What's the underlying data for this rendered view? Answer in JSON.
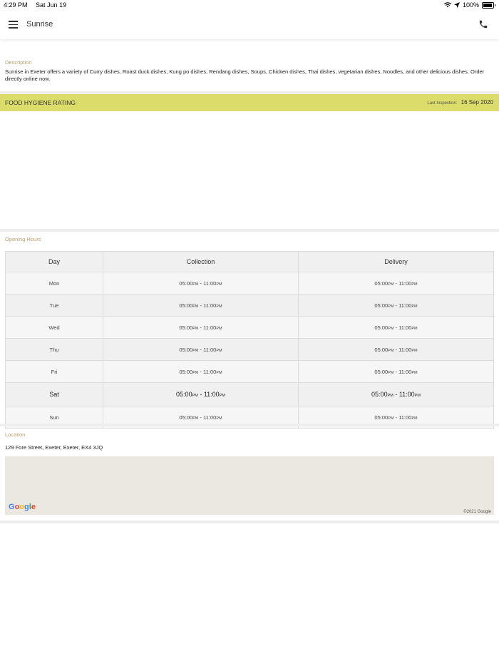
{
  "status_bar": {
    "time": "4:29 PM",
    "date": "Sat Jun 19",
    "battery": "100%"
  },
  "nav": {
    "title": "Sunrise"
  },
  "description": {
    "label": "Description",
    "text": "Sunrise in Exeter offers a variety of Curry dishes, Roast duck dishes, Kung po dishes, Rendang dishes, Soups, Chicken dishes, Thai dishes, vegetarian dishes, Noodles, and other delicious dishes. Order directly online now."
  },
  "hygiene": {
    "title": "FOOD HYGIENE RATING",
    "inspection_label": "Last Inspection:",
    "inspection_date": "16 Sep 2020",
    "bar_color": "#dcdc6a"
  },
  "hours": {
    "label": "Opening Hours",
    "headers": [
      "Day",
      "Collection",
      "Delivery"
    ],
    "rows": [
      {
        "day": "Mon",
        "c_open": "05:00",
        "c_close": "11:00",
        "d_open": "05:00",
        "d_close": "11:00"
      },
      {
        "day": "Tue",
        "c_open": "05:00",
        "c_close": "11:00",
        "d_open": "05:00",
        "d_close": "11:00"
      },
      {
        "day": "Wed",
        "c_open": "05:00",
        "c_close": "11:00",
        "d_open": "05:00",
        "d_close": "11:00"
      },
      {
        "day": "Thu",
        "c_open": "05:00",
        "c_close": "11:00",
        "d_open": "05:00",
        "d_close": "11:00"
      },
      {
        "day": "Fri",
        "c_open": "05:00",
        "c_close": "11:00",
        "d_open": "05:00",
        "d_close": "11:00"
      },
      {
        "day": "Sat",
        "c_open": "05:00",
        "c_close": "11:00",
        "d_open": "05:00",
        "d_close": "11:00"
      },
      {
        "day": "Sun",
        "c_open": "05:00",
        "c_close": "11:00",
        "d_open": "05:00",
        "d_close": "11:00"
      }
    ],
    "ampm": "PM",
    "separator": " - "
  },
  "location": {
    "label": "Location",
    "address": "129 Fore Street, Exeter, Exeter, EX4 3JQ",
    "map_logo": "Google",
    "copyright": "©2021 Google"
  },
  "colors": {
    "accent_label": "#b8a06e",
    "map_bg": "#ebe8e2"
  }
}
